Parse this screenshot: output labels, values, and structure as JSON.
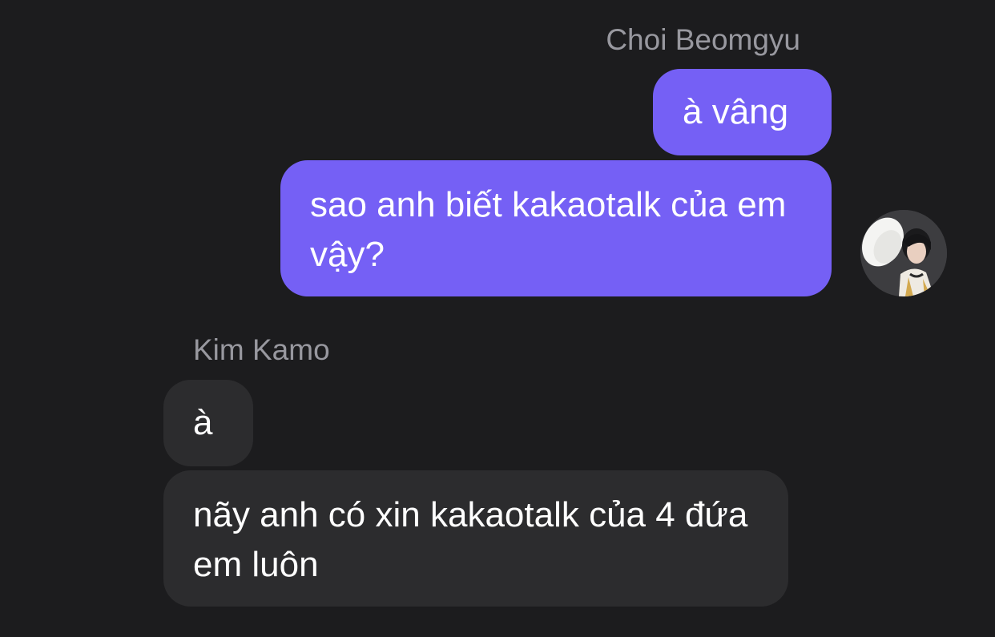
{
  "conversation": {
    "outgoing": {
      "sender_name": "Choi Beomgyu",
      "messages": [
        {
          "text": "à vâng"
        },
        {
          "text": "sao anh biết kakaotalk của em vậy?"
        }
      ],
      "avatar_icon": "profile-photo-avatar"
    },
    "incoming": {
      "sender_name": "Kim Kamo",
      "messages": [
        {
          "text": "à"
        },
        {
          "text": "nãy anh có xin kakaotalk của 4 đứa em luôn"
        }
      ]
    }
  },
  "colors": {
    "background": "#1c1c1e",
    "outgoing_bubble": "#7560f5",
    "incoming_bubble": "#2c2c2e",
    "sender_name": "#98989f",
    "message_text": "#ffffff"
  }
}
